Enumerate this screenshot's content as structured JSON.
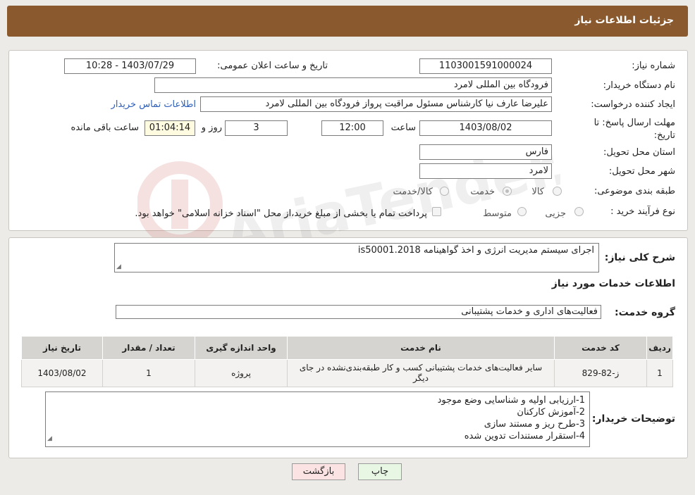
{
  "header": {
    "title": "جزئیات اطلاعات نیاز"
  },
  "form": {
    "need_number_label": "شماره نیاز:",
    "need_number": "1103001591000024",
    "announce_label": "تاریخ و ساعت اعلان عمومی:",
    "announce_value": "1403/07/29 - 10:28",
    "buyer_label": "نام دستگاه خریدار:",
    "buyer_value": "فرودگاه بین المللی لامرد",
    "requester_label": "ایجاد کننده درخواست:",
    "requester_value": "علیرضا عارف نیا کارشناس مسئول مراقبت پرواز فرودگاه بین المللی لامرد",
    "contact_link": "اطلاعات تماس خریدار",
    "deadline_label": "مهلت ارسال پاسخ: تا تاریخ:",
    "deadline_date": "1403/08/02",
    "time_label": "ساعت",
    "deadline_time": "12:00",
    "days_value": "3",
    "days_label": "روز و",
    "remaining_value": "01:04:14",
    "remaining_label": "ساعت باقی مانده",
    "province_label": "استان محل تحویل:",
    "province_value": "فارس",
    "city_label": "شهر محل تحویل:",
    "city_value": "لامرد",
    "category_label": "طبقه بندی موضوعی:",
    "category_options": [
      "کالا",
      "خدمت",
      "کالا/خدمت"
    ],
    "process_label": "نوع فرآیند خرید :",
    "process_options": [
      "جزیی",
      "متوسط"
    ],
    "payment_note": "پرداخت تمام یا بخشی از مبلغ خرید،از محل \"اسناد خزانه اسلامی\" خواهد بود."
  },
  "details": {
    "summary_label": "شرح کلی نیاز:",
    "summary_value": "اجرای سیستم مدیریت انرژی و اخذ گواهینامه is50001.2018",
    "services_heading": "اطلاعات خدمات مورد نیاز",
    "group_label": "گروه خدمت:",
    "group_value": "فعالیت‌های اداری و خدمات پشتیبانی"
  },
  "table": {
    "headers": [
      "ردیف",
      "کد خدمت",
      "نام خدمت",
      "واحد اندازه گیری",
      "تعداد / مقدار",
      "تاریخ نیاز"
    ],
    "rows": [
      [
        "1",
        "ز-82-829",
        "سایر فعالیت‌های خدمات پشتیبانی کسب و کار طبقه‌بندی‌نشده در جای دیگر",
        "پروژه",
        "1",
        "1403/08/02"
      ]
    ]
  },
  "notes": {
    "label": "توضیحات خریدار:",
    "lines": [
      "1-ارزیابی اولیه و شناسایی وضع موجود",
      "2-آموزش کارکنان",
      "3-طرح ریز و مستند سازی",
      "4-استقرار مستندات تدوین شده"
    ]
  },
  "buttons": {
    "print": "چاپ",
    "back": "بازگشت"
  },
  "colors": {
    "header": "#8a5a2e",
    "print_bg": "#e8f7e4",
    "back_bg": "#fbe3e3"
  }
}
